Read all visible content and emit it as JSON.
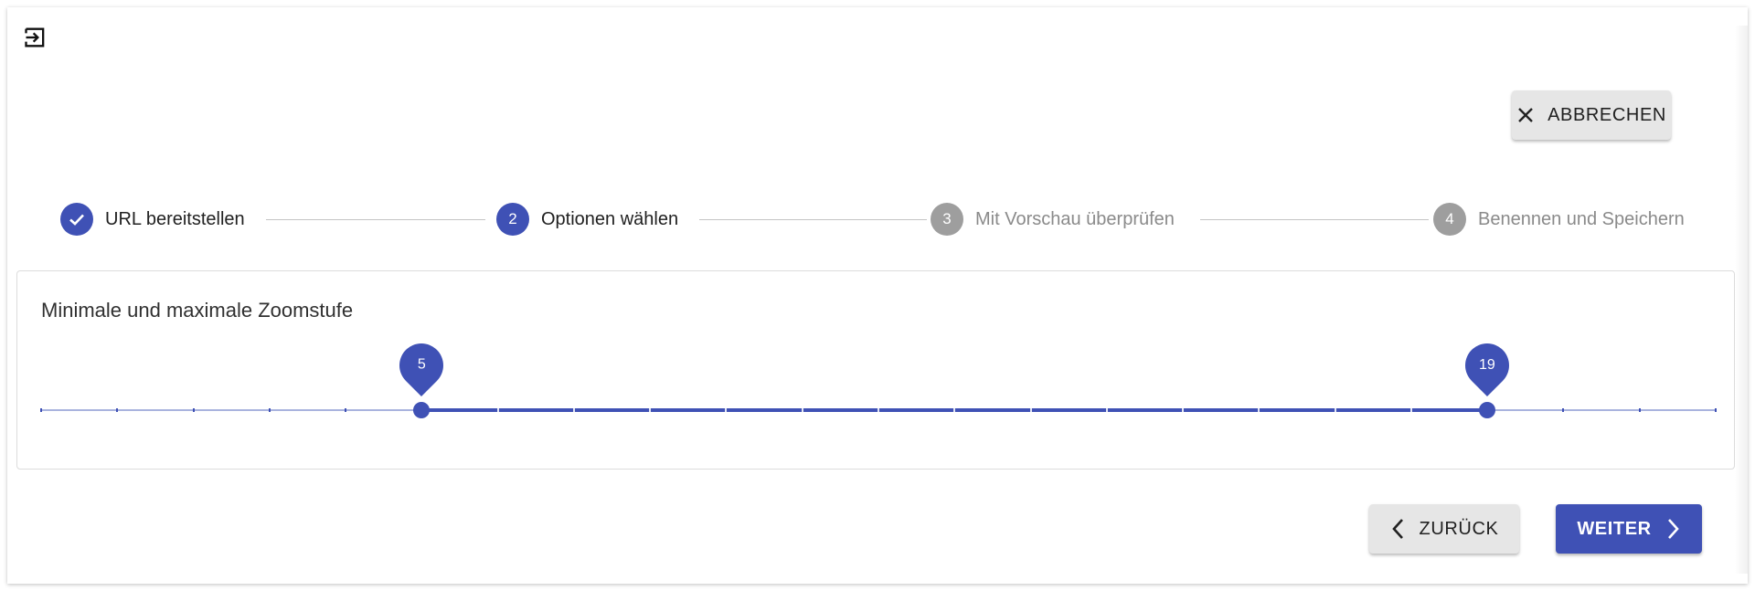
{
  "header": {
    "exit_icon": "exit-to-app-icon",
    "cancel_icon": "close-icon",
    "cancel_label": "ABBRECHEN"
  },
  "stepper": {
    "steps": [
      {
        "number": "1",
        "label": "URL bereitstellen",
        "state": "completed",
        "icon": "check-icon"
      },
      {
        "number": "2",
        "label": "Optionen wählen",
        "state": "active"
      },
      {
        "number": "3",
        "label": "Mit Vorschau überprüfen",
        "state": "inactive"
      },
      {
        "number": "4",
        "label": "Benennen und Speichern",
        "state": "inactive"
      }
    ]
  },
  "zoom": {
    "title": "Minimale und maximale Zoomstufe",
    "min": 0,
    "max": 22,
    "step": 1,
    "low_value": "5",
    "high_value": "19"
  },
  "navigation": {
    "back_label": "ZURÜCK",
    "back_icon": "chevron-left-icon",
    "next_label": "WEITER",
    "next_icon": "chevron-right-icon"
  },
  "colors": {
    "accent": "#3f51b5",
    "inactive_step": "#9e9e9e",
    "track_inactive": "#a9b3de"
  }
}
